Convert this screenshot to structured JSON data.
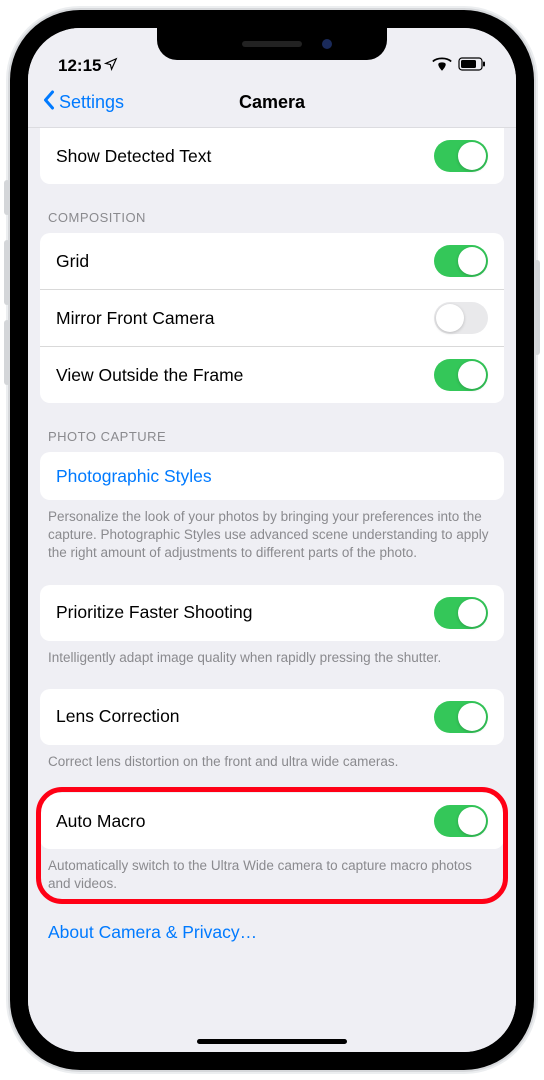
{
  "status": {
    "time": "12:15"
  },
  "nav": {
    "back": "Settings",
    "title": "Camera"
  },
  "rows": {
    "detected_text": {
      "label": "Show Detected Text",
      "on": true
    },
    "composition_header": "COMPOSITION",
    "grid": {
      "label": "Grid",
      "on": true
    },
    "mirror": {
      "label": "Mirror Front Camera",
      "on": false
    },
    "view_outside": {
      "label": "View Outside the Frame",
      "on": true
    },
    "photo_capture_header": "PHOTO CAPTURE",
    "photo_styles": {
      "label": "Photographic Styles"
    },
    "photo_styles_footer": "Personalize the look of your photos by bringing your preferences into the capture. Photographic Styles use advanced scene understanding to apply the right amount of adjustments to different parts of the photo.",
    "faster": {
      "label": "Prioritize Faster Shooting",
      "on": true
    },
    "faster_footer": "Intelligently adapt image quality when rapidly pressing the shutter.",
    "lens": {
      "label": "Lens Correction",
      "on": true
    },
    "lens_footer": "Correct lens distortion on the front and ultra wide cameras.",
    "macro": {
      "label": "Auto Macro",
      "on": true
    },
    "macro_footer": "Automatically switch to the Ultra Wide camera to capture macro photos and videos.",
    "about": "About Camera & Privacy…"
  }
}
